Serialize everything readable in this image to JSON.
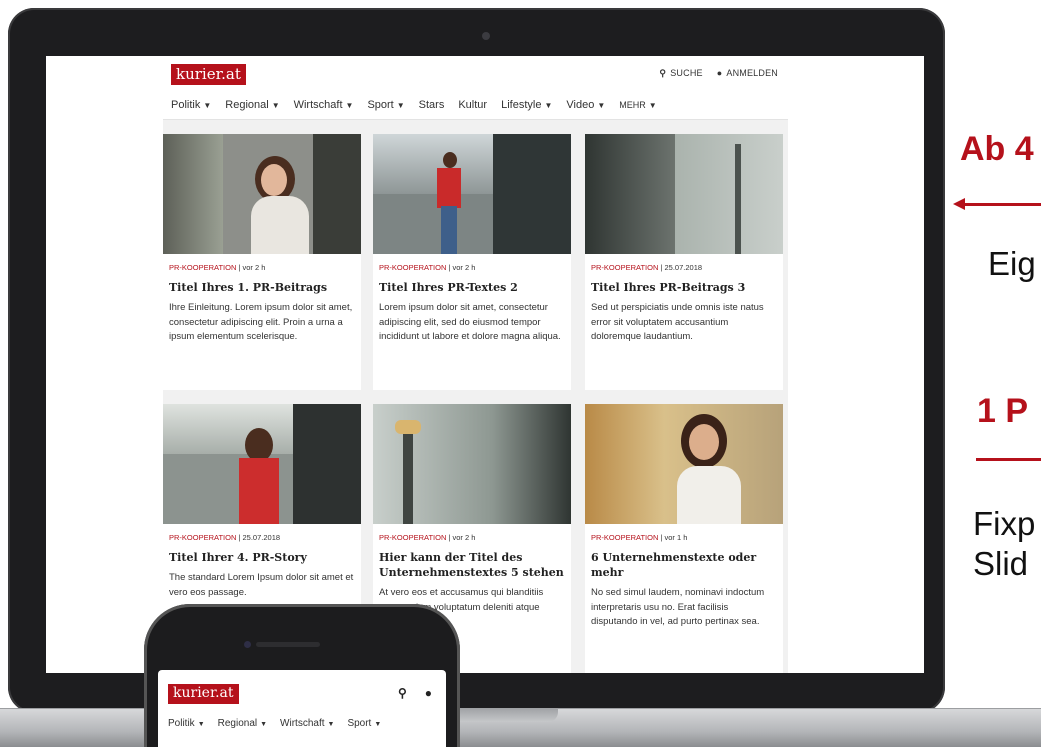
{
  "site": {
    "logo": "kurier.at",
    "search_label": "SUCHE",
    "login_label": "ANMELDEN",
    "nav": [
      "Politik",
      "Regional",
      "Wirtschaft",
      "Sport",
      "Stars",
      "Kultur",
      "Lifestyle",
      "Video",
      "MEHR"
    ],
    "cards": [
      {
        "tag": "PR-KOOPERATION",
        "time": "| vor 2 h",
        "title": "Titel Ihres 1. PR-Beitrags",
        "text": "Ihre Einleitung. Lorem ipsum dolor sit amet, consectetur adipiscing elit. Proin a urna a ipsum elementum scelerisque."
      },
      {
        "tag": "PR-KOOPERATION",
        "time": "| vor 2 h",
        "title": "Titel Ihres PR-Textes 2",
        "text": "Lorem ipsum dolor sit amet, consectetur adipiscing elit, sed do eiusmod tempor incididunt ut labore et dolore magna aliqua."
      },
      {
        "tag": "PR-KOOPERATION",
        "time": "| 25.07.2018",
        "title": "Titel Ihres PR-Beitrags 3",
        "text": "Sed ut perspiciatis unde omnis iste natus error sit voluptatem accusantium doloremque laudantium."
      },
      {
        "tag": "PR-KOOPERATION",
        "time": "| 25.07.2018",
        "title": "Titel Ihrer 4. PR-Story",
        "text": "The standard Lorem Ipsum dolor sit amet et vero eos passage."
      },
      {
        "tag": "PR-KOOPERATION",
        "time": "| vor 2 h",
        "title": "Hier kann der Titel des Unternehmenstextes 5 stehen",
        "text": "At vero eos et accusamus qui blanditiis praesentium voluptatum deleniti atque corrupti"
      },
      {
        "tag": "PR-KOOPERATION",
        "time": "| vor 1 h",
        "title": "6 Unternehmenstexte oder mehr",
        "text": "No sed simul laudem, nominavi indoctum interpretaris usu no. Erat facilisis disputando in vel, ad purto pertinax sea."
      }
    ]
  },
  "phone": {
    "logo": "kurier.at",
    "nav": [
      "Politik",
      "Regional",
      "Wirtschaft",
      "Sport"
    ]
  },
  "callouts": {
    "heading1": "Ab 4",
    "text1": "Eig",
    "heading2": "1 P",
    "text2_line1": "Fixp",
    "text2_line2": "Slid"
  },
  "colors": {
    "brand_red": "#b5111b"
  }
}
